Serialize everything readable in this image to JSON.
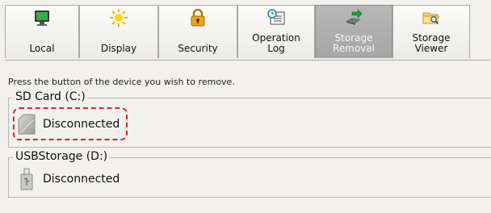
{
  "tabs": [
    {
      "label": "Local",
      "icon": "monitor-icon",
      "active": false
    },
    {
      "label": "Display",
      "icon": "sun-icon",
      "active": false
    },
    {
      "label": "Security",
      "icon": "lock-icon",
      "active": false
    },
    {
      "label": "Operation\nLog",
      "icon": "log-clock-icon",
      "active": false
    },
    {
      "label": "Storage\nRemoval",
      "icon": "storage-removal-icon",
      "active": true
    },
    {
      "label": "Storage\nViewer",
      "icon": "folder-search-icon",
      "active": false
    }
  ],
  "instruction": "Press the button of the device you wish to remove.",
  "devices": [
    {
      "group_label": "SD Card (C:)",
      "status": "Disconnected",
      "icon": "sd-card-icon",
      "highlighted": true
    },
    {
      "group_label": "USBStorage (D:)",
      "status": "Disconnected",
      "icon": "usb-drive-icon",
      "highlighted": false
    }
  ],
  "colors": {
    "highlight": "#d9262c",
    "active_tab": "#aaaaaa"
  }
}
